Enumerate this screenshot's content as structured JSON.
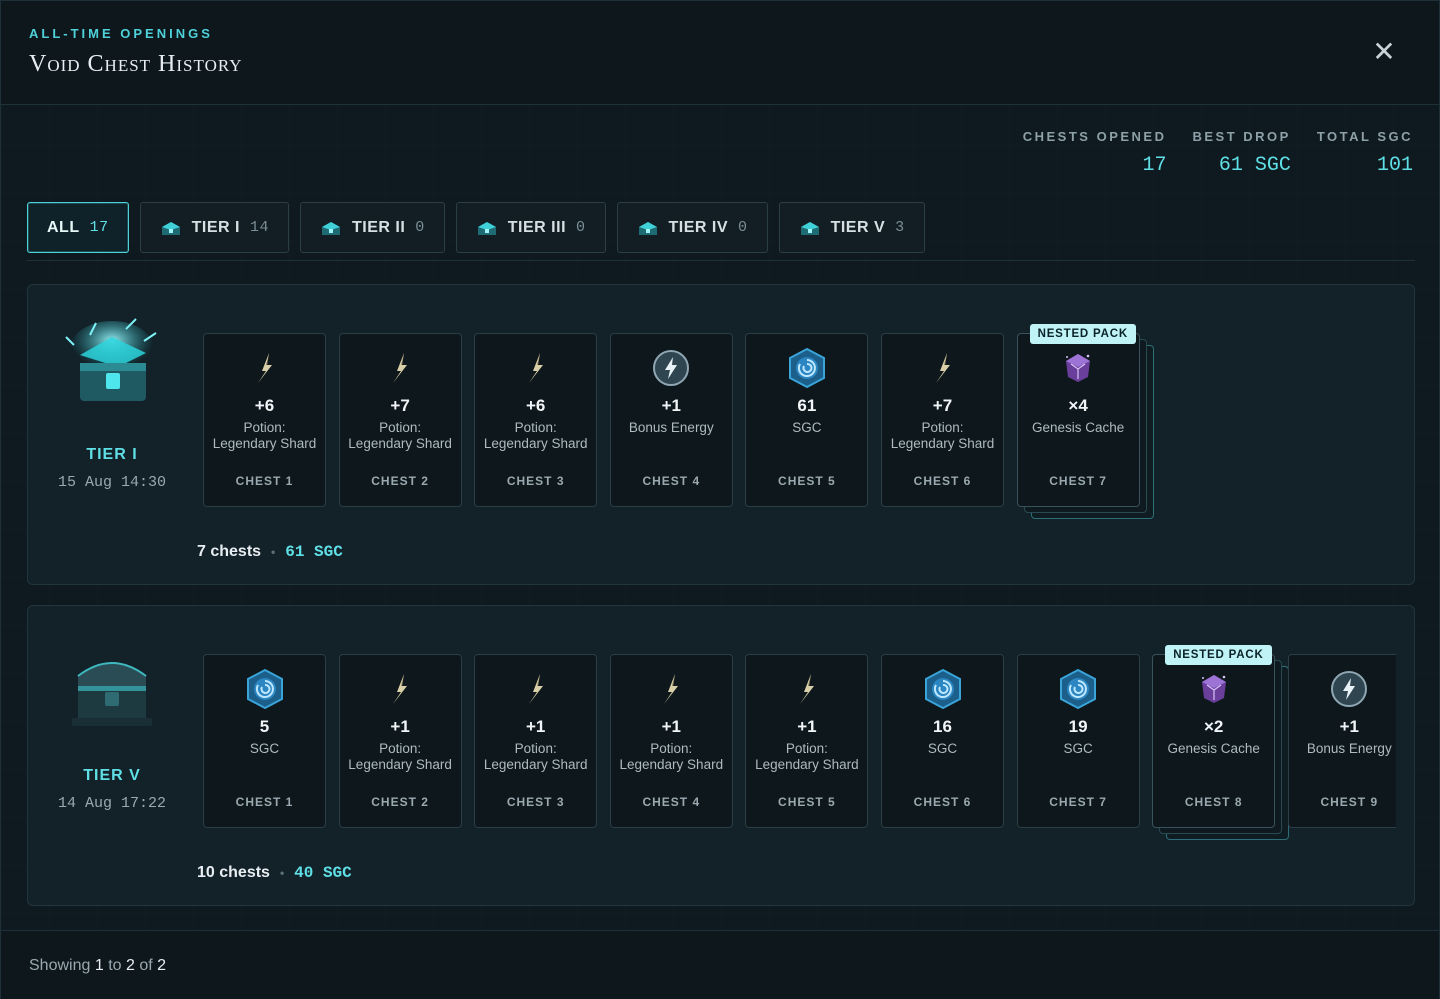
{
  "header": {
    "eyebrow": "ALL-TIME OPENINGS",
    "title": "Void Chest History",
    "close_label": "✕"
  },
  "stats": [
    {
      "label": "CHESTS OPENED",
      "value": "17"
    },
    {
      "label": "BEST DROP",
      "value": "61 SGC"
    },
    {
      "label": "TOTAL SGC",
      "value": "101"
    }
  ],
  "tabs": [
    {
      "label": "ALL",
      "count": "17",
      "active": true,
      "icon": ""
    },
    {
      "label": "TIER I",
      "count": "14",
      "icon": "chest-tier-1-icon"
    },
    {
      "label": "TIER II",
      "count": "0",
      "icon": "chest-tier-2-icon"
    },
    {
      "label": "TIER III",
      "count": "0",
      "icon": "chest-tier-3-icon"
    },
    {
      "label": "TIER IV",
      "count": "0",
      "icon": "chest-tier-4-icon"
    },
    {
      "label": "TIER V",
      "count": "3",
      "icon": "chest-tier-5-icon"
    }
  ],
  "colors": {
    "accent": "#5fe0e6",
    "badge": "#bff3f5",
    "panel": "#132128"
  },
  "groups": [
    {
      "tier": "TIER I",
      "date": "15 Aug 14:30",
      "art": "glowing-open-chest-icon",
      "summary_count": "7 chests",
      "summary_sgc": "61 SGC",
      "cards": [
        {
          "icon": "shard-icon",
          "amount": "+6",
          "name": "Potion: Legendary Shard",
          "slot": "CHEST 1"
        },
        {
          "icon": "shard-icon",
          "amount": "+7",
          "name": "Potion: Legendary Shard",
          "slot": "CHEST 2"
        },
        {
          "icon": "shard-icon",
          "amount": "+6",
          "name": "Potion: Legendary Shard",
          "slot": "CHEST 3"
        },
        {
          "icon": "energy-icon",
          "amount": "+1",
          "name": "Bonus Energy",
          "slot": "CHEST 4"
        },
        {
          "icon": "sgc-coin-icon",
          "amount": "61",
          "name": "SGC",
          "slot": "CHEST 5"
        },
        {
          "icon": "shard-icon",
          "amount": "+7",
          "name": "Potion: Legendary Shard",
          "slot": "CHEST 6"
        },
        {
          "icon": "genesis-cache-icon",
          "amount": "×4",
          "name": "Genesis Cache",
          "slot": "CHEST 7",
          "nested": true,
          "badge": "NESTED PACK"
        }
      ]
    },
    {
      "tier": "TIER V",
      "date": "14 Aug 17:22",
      "art": "closed-chest-icon",
      "summary_count": "10 chests",
      "summary_sgc": "40 SGC",
      "cards": [
        {
          "icon": "sgc-coin-icon",
          "amount": "5",
          "name": "SGC",
          "slot": "CHEST 1"
        },
        {
          "icon": "shard-icon",
          "amount": "+1",
          "name": "Potion: Legendary Shard",
          "slot": "CHEST 2"
        },
        {
          "icon": "shard-icon",
          "amount": "+1",
          "name": "Potion: Legendary Shard",
          "slot": "CHEST 3"
        },
        {
          "icon": "shard-icon",
          "amount": "+1",
          "name": "Potion: Legendary Shard",
          "slot": "CHEST 4"
        },
        {
          "icon": "shard-icon",
          "amount": "+1",
          "name": "Potion: Legendary Shard",
          "slot": "CHEST 5"
        },
        {
          "icon": "sgc-coin-icon",
          "amount": "16",
          "name": "SGC",
          "slot": "CHEST 6"
        },
        {
          "icon": "sgc-coin-icon",
          "amount": "19",
          "name": "SGC",
          "slot": "CHEST 7"
        },
        {
          "icon": "genesis-cache-icon",
          "amount": "×2",
          "name": "Genesis Cache",
          "slot": "CHEST 8",
          "nested": true,
          "badge": "NESTED PACK"
        },
        {
          "icon": "energy-icon",
          "amount": "+1",
          "name": "Bonus Energy",
          "slot": "CHEST 9"
        }
      ]
    }
  ],
  "footer": {
    "prefix": "Showing",
    "from": "1",
    "to_word": "to",
    "to": "2",
    "of_word": "of",
    "total": "2"
  }
}
